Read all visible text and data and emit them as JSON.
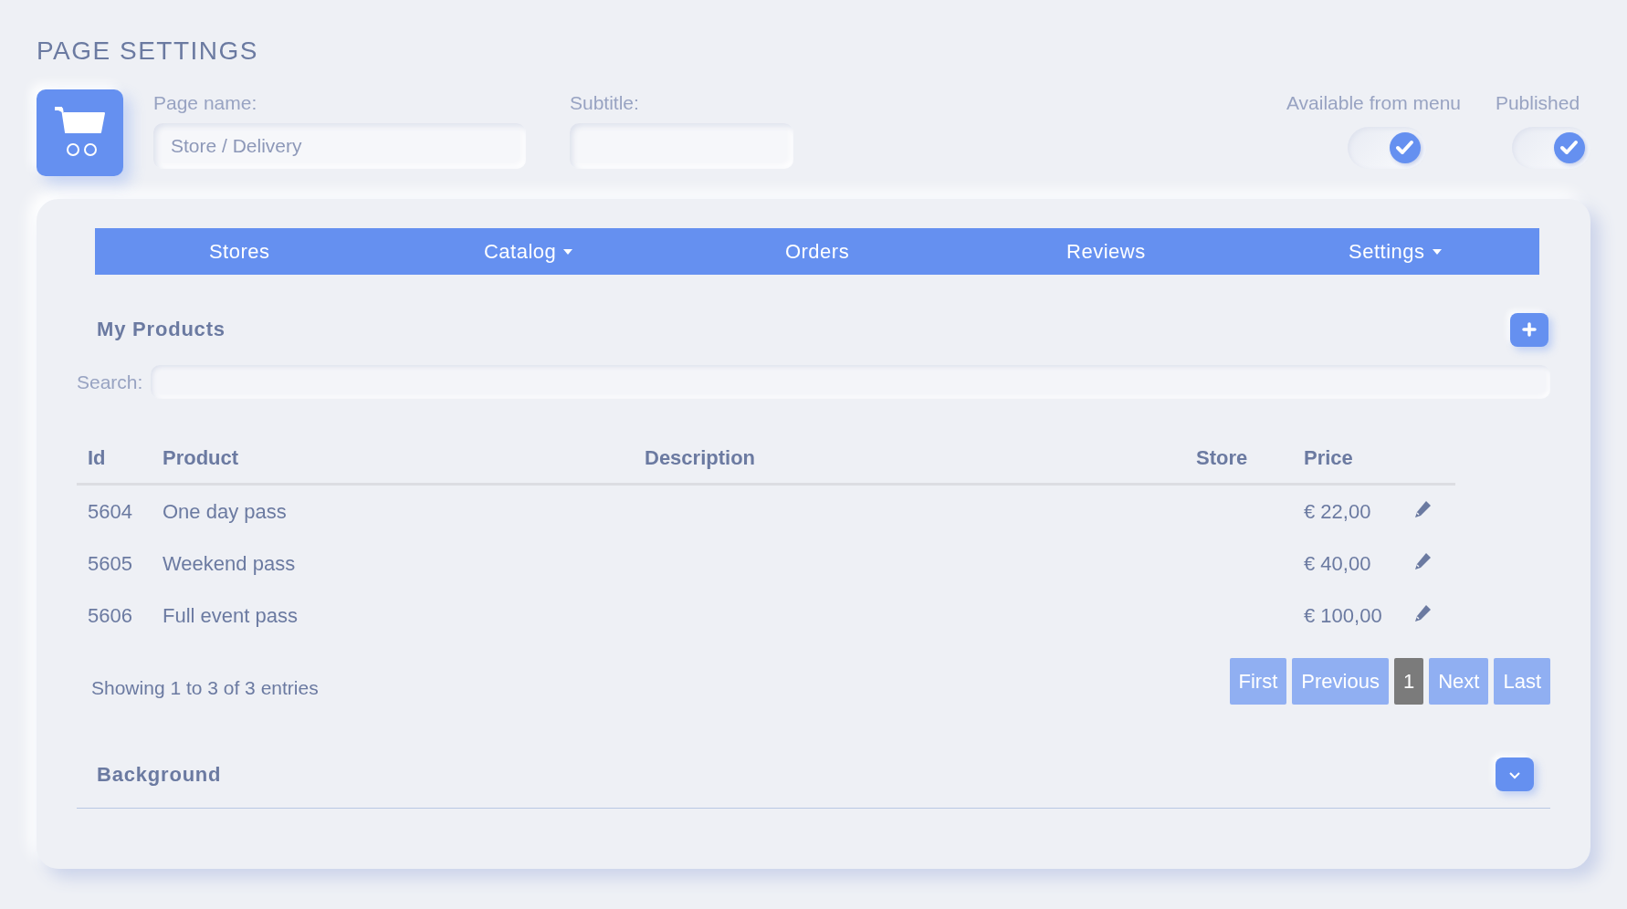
{
  "page_title": "PAGE SETTINGS",
  "fields": [
    {
      "label": "Page name:",
      "value": "Store / Delivery"
    },
    {
      "label": "Subtitle:"
    }
  ],
  "toggles": [
    {
      "label": "Available from menu",
      "on": true
    },
    {
      "label": "Published",
      "on": true
    }
  ],
  "nav": [
    {
      "label": "Stores",
      "dropdown": false
    },
    {
      "label": "Catalog",
      "dropdown": true
    },
    {
      "label": "Orders",
      "dropdown": false
    },
    {
      "label": "Reviews",
      "dropdown": false
    },
    {
      "label": "Settings",
      "dropdown": true
    }
  ],
  "products": {
    "title": "My Products",
    "search_label": "Search:",
    "table": {
      "columns": [
        "Id",
        "Product",
        "Description",
        "Store",
        "Price"
      ],
      "rows": [
        {
          "id": "5604",
          "product": "One day pass",
          "price": "€ 22,00"
        },
        {
          "id": "5605",
          "product": "Weekend pass",
          "price": "€ 40,00"
        },
        {
          "id": "5606",
          "product": "Full event pass",
          "price": "€ 100,00"
        }
      ]
    },
    "info": "Showing 1 to 3 of 3 entries",
    "pagination": [
      {
        "label": "First",
        "selected": false
      },
      {
        "label": "Previous",
        "selected": false
      },
      {
        "label": "1",
        "selected": true
      },
      {
        "label": "Next",
        "selected": false
      },
      {
        "label": "Last",
        "selected": false
      }
    ]
  },
  "background_section": {
    "title": "Background",
    "expanded": false
  }
}
